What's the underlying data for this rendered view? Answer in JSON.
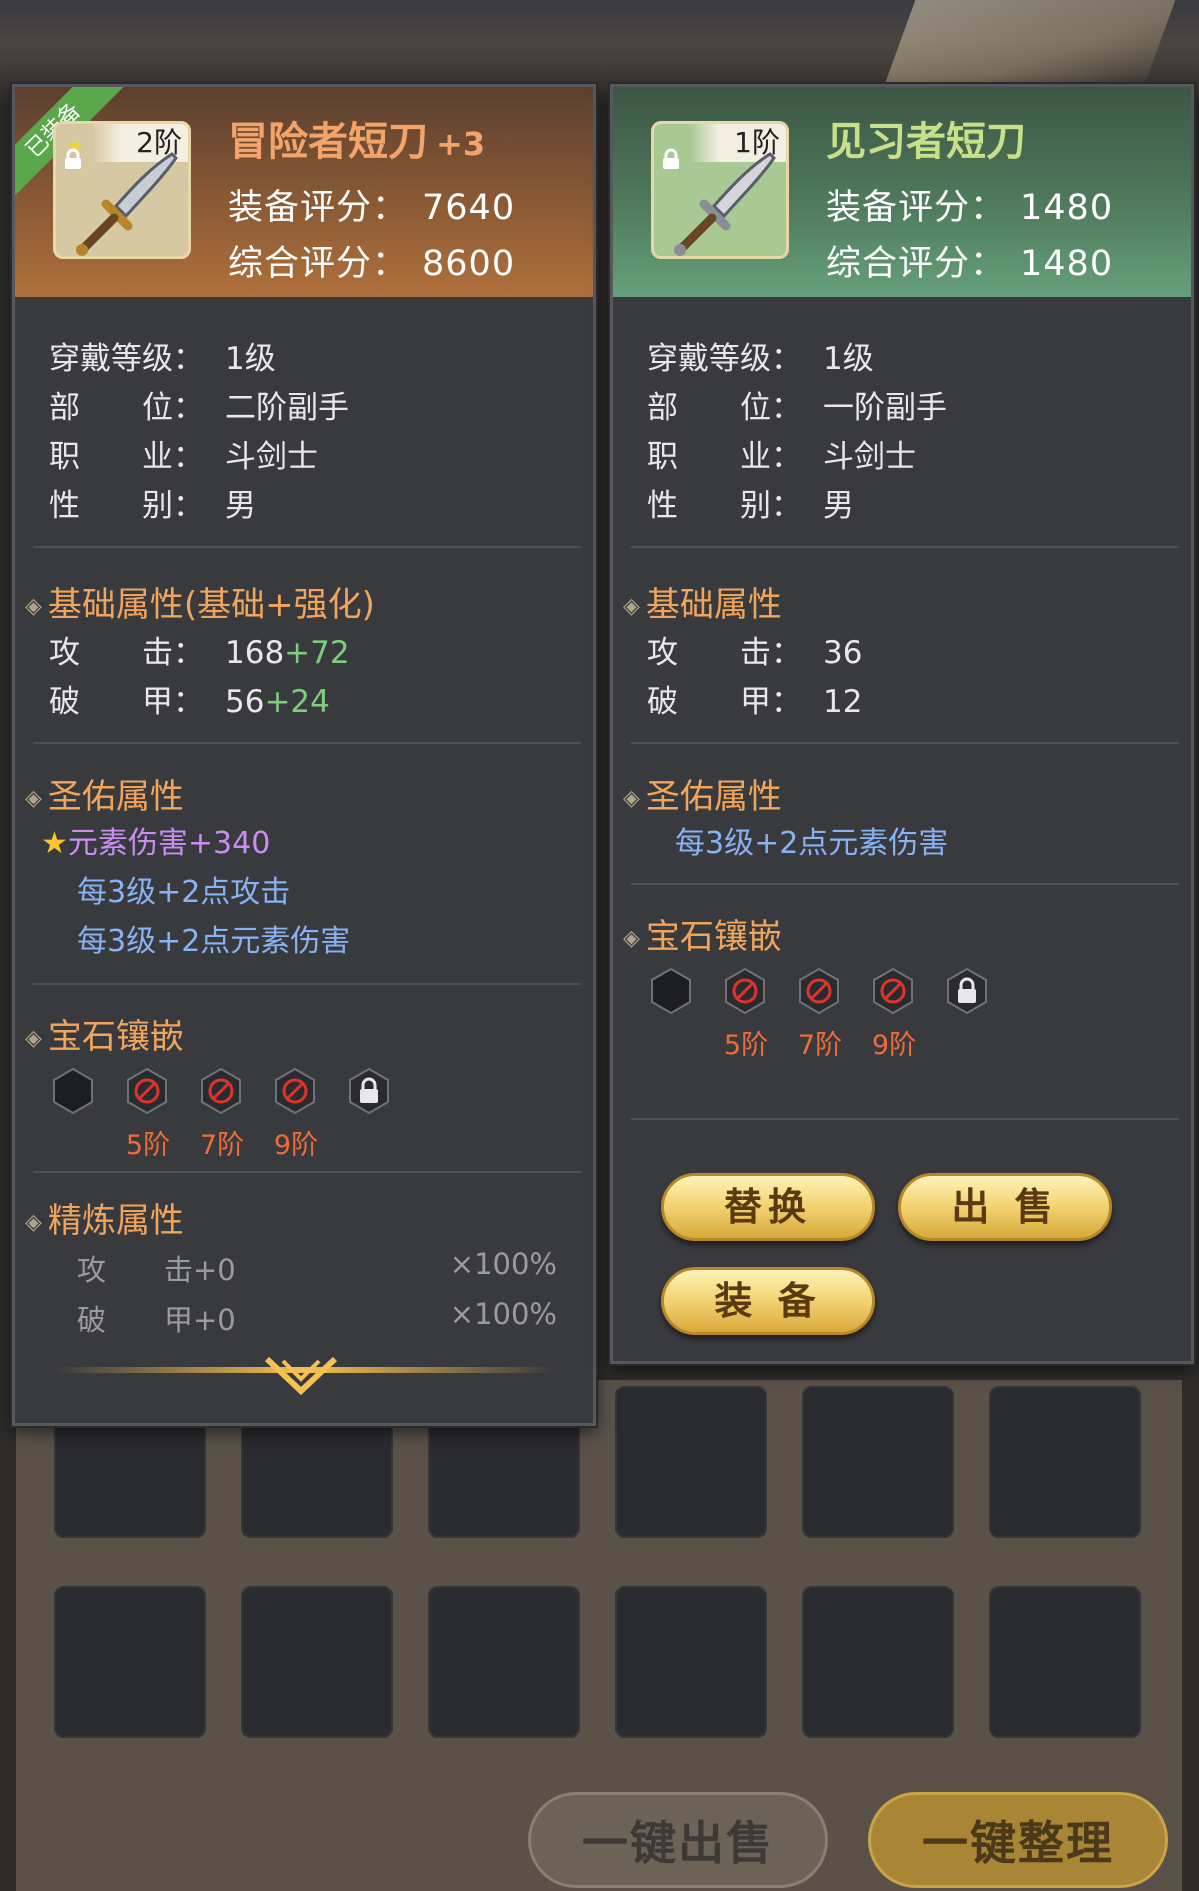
{
  "equipped_item": {
    "badge": "已装备",
    "tier": "2阶",
    "name": "冒险者短刀",
    "enhance": "+3",
    "equip_score_label": "装备评分：",
    "equip_score": "7640",
    "total_score_label": "综合评分：",
    "total_score": "8600",
    "info": [
      {
        "key": "穿戴等级：",
        "value": "1级"
      },
      {
        "key": "部　　位：",
        "value": "二阶副手"
      },
      {
        "key": "职　　业：",
        "value": "斗剑士"
      },
      {
        "key": "性　　别：",
        "value": "男"
      }
    ],
    "base_title": "基础属性(基础+强化)",
    "base_stats": [
      {
        "key": "攻　　击：",
        "base": "168",
        "bonus": "+72"
      },
      {
        "key": "破　　甲：",
        "base": "56",
        "bonus": "+24"
      }
    ],
    "holy_title": "圣佑属性",
    "holy_main": "元素伤害+340",
    "holy_lines": [
      "每3级+2点攻击",
      "每3级+2点元素伤害"
    ],
    "gem_title": "宝石镶嵌",
    "gem_labels": [
      "5阶",
      "7阶",
      "9阶"
    ],
    "refine_title": "精炼属性",
    "refine": [
      {
        "key": "攻　　击+0",
        "pct": "×100%"
      },
      {
        "key": "破　　甲+0",
        "pct": "×100%"
      }
    ]
  },
  "compare_item": {
    "tier": "1阶",
    "name": "见习者短刀",
    "equip_score_label": "装备评分：",
    "equip_score": "1480",
    "total_score_label": "综合评分：",
    "total_score": "1480",
    "info": [
      {
        "key": "穿戴等级：",
        "value": "1级"
      },
      {
        "key": "部　　位：",
        "value": "一阶副手"
      },
      {
        "key": "职　　业：",
        "value": "斗剑士"
      },
      {
        "key": "性　　别：",
        "value": "男"
      }
    ],
    "base_title": "基础属性",
    "base_stats": [
      {
        "key": "攻　　击：",
        "base": "36"
      },
      {
        "key": "破　　甲：",
        "base": "12"
      }
    ],
    "holy_title": "圣佑属性",
    "holy_lines": [
      "每3级+2点元素伤害"
    ],
    "gem_title": "宝石镶嵌",
    "gem_labels": [
      "5阶",
      "7阶",
      "9阶"
    ],
    "buttons": {
      "replace": "替换",
      "sell": "出 售",
      "equip": "装 备"
    }
  },
  "bottom_bar": {
    "sell_all": "一键出售",
    "tidy": "一键整理"
  }
}
